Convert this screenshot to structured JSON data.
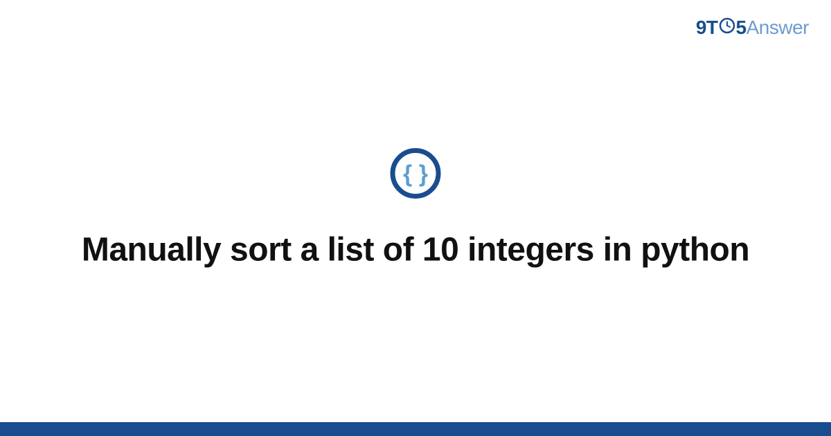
{
  "logo": {
    "part1": "9T",
    "part2": "5",
    "part3": "Answer"
  },
  "main": {
    "title": "Manually sort a list of 10 integers in python"
  },
  "colors": {
    "primary_blue": "#1a4d8f",
    "light_blue": "#6b9bd1",
    "icon_inner": "#5a9fd4"
  }
}
